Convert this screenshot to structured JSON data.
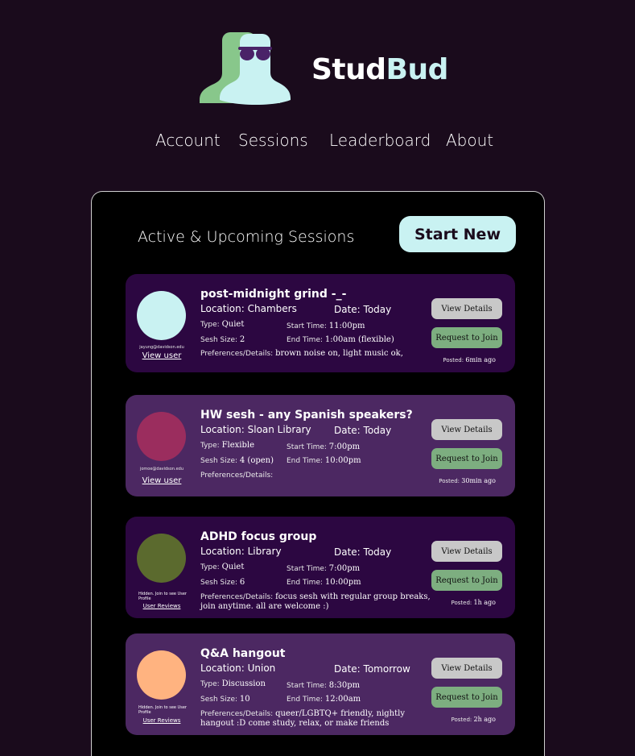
{
  "brand": {
    "part1": "Stud",
    "part2": "Bud",
    "logo_icon": "two-person-sunglasses-icon",
    "colors": {
      "green": "#88c78b",
      "cyan": "#c9f2f2",
      "lens": "#4a2368"
    }
  },
  "nav": {
    "account": "Account",
    "sessions": "Sessions",
    "leaderboard": "Leaderboard",
    "about": "About"
  },
  "panel": {
    "title": "Active & Upcoming Sessions",
    "start_new": "Start New"
  },
  "labels": {
    "type": "Type:",
    "sesh_size": "Sesh Size:",
    "start_time": "Start Time:",
    "end_time": "End Time:",
    "prefs": "Preferences/Details:",
    "view_details": "View Details",
    "request_join": "Request to Join",
    "posted": "Posted:",
    "view_user": "View user",
    "user_reviews": "User Reviews",
    "hidden_note": "Hidden. Join to see User Profile"
  },
  "sessions": [
    {
      "title": "post-midnight grind  -_-",
      "location": "Location: Chambers",
      "date": "Date: Today",
      "type": "Quiet",
      "size": "2",
      "start": "11:00pm",
      "end": "1:00am (flexible)",
      "prefs": "brown noise on, light music ok,",
      "posted": "6min ago",
      "email": "jayung@davidson.edu",
      "avatar_color": "#c9f2f2"
    },
    {
      "title": "HW sesh - any Spanish speakers?",
      "location": "Location: Sloan Library",
      "date": "Date: Today",
      "type": "Flexible",
      "size": "4 (open)",
      "start": "7:00pm",
      "end": "10:00pm",
      "prefs": "",
      "posted": "30min ago",
      "email": "jomoe@davidson.edu",
      "avatar_color": "#9b2d5e"
    },
    {
      "title": "ADHD focus group",
      "location": "Location: Library",
      "date": "Date: Today",
      "type": "Quiet",
      "size": "6",
      "start": "7:00pm",
      "end": "10:00pm",
      "prefs": "focus sesh with regular group breaks, join anytime. all are welcome :)",
      "posted": "1h ago",
      "avatar_color": "#5b6a2e"
    },
    {
      "title": "Q&A hangout",
      "location": "Location: Union",
      "date": "Date: Tomorrow",
      "type": "Discussion",
      "size": "10",
      "start": "8:30pm",
      "end": "12:00am",
      "prefs": "queer/LGBTQ+ friendly, nightly hangout :D come study, relax, or make friends",
      "posted": "2h ago",
      "avatar_color": "#ffb380"
    }
  ]
}
